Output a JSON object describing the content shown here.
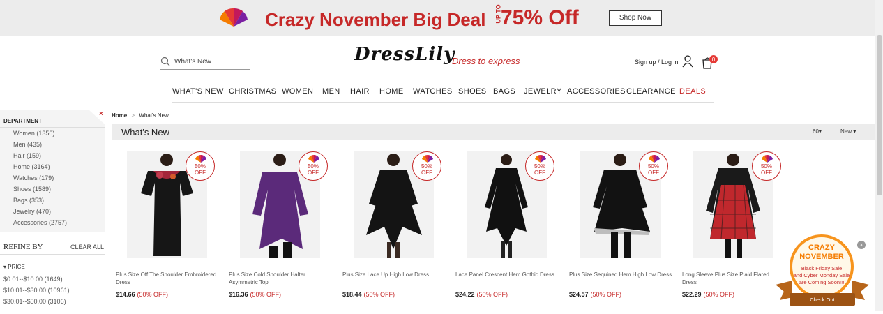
{
  "promo": {
    "headline": "Crazy November Big Deal",
    "upto": "UP TO",
    "percent": "75% Off",
    "button": "Shop Now"
  },
  "header": {
    "search_placeholder": "What's New",
    "brand": "DressLily",
    "tagline": "Dress to express",
    "signin": "Sign up / Log in",
    "cart_count": "0"
  },
  "nav": [
    "WHAT'S NEW",
    "CHRISTMAS",
    "WOMEN",
    "MEN",
    "HAIR",
    "HOME",
    "WATCHES",
    "SHOES",
    "BAGS",
    "JEWELRY",
    "ACCESSORIES",
    "CLEARANCE",
    "DEALS"
  ],
  "sidebar": {
    "title": "DEPARTMENT",
    "close": "×",
    "departments": [
      "Women (1356)",
      "Men (435)",
      "Hair (159)",
      "Home (3164)",
      "Watches (179)",
      "Shoes (1589)",
      "Bags (353)",
      "Jewelry (470)",
      "Accessories (2757)"
    ],
    "refine": "REFINE BY",
    "clear": "CLEAR ALL",
    "price_heading": "▾ PRICE",
    "prices": [
      "$0.01--$10.00 (1649)",
      "$10.01--$30.00 (10961)",
      "$30.01--$50.00 (3106)"
    ]
  },
  "breadcrumb": {
    "home": "Home",
    "sep": ">",
    "current": "What's New"
  },
  "listing": {
    "title": "What's New",
    "per_page": "60▾",
    "sort": "New ▾"
  },
  "badge": {
    "pct": "50%",
    "off": "OFF"
  },
  "products": [
    {
      "name": "Plus Size Off The Shoulder Embroidered Dress",
      "price": "$14.66",
      "discount": "(50% OFF)"
    },
    {
      "name": "Plus Size Cold Shoulder Halter Asymmetric Top",
      "price": "$16.36",
      "discount": "(50% OFF)"
    },
    {
      "name": "Plus Size Lace Up High Low Dress",
      "price": "$18.44",
      "discount": "(50% OFF)"
    },
    {
      "name": "Lace Panel Crescent Hem Gothic Dress",
      "price": "$24.22",
      "discount": "(50% OFF)"
    },
    {
      "name": "Plus Size Sequined Hem High Low Dress",
      "price": "$24.57",
      "discount": "(50% OFF)"
    },
    {
      "name": "Long Sleeve Plus Size Plaid Flared Dress",
      "price": "$22.29",
      "discount": "(50% OFF)"
    }
  ],
  "popup": {
    "crazy": "CRAZY",
    "november": "NOVEMBER",
    "line1": "Black Friday Sale",
    "line2": "and Cyber Monday Sale",
    "line3": "are Coming Soon!!!",
    "cta": "Check Out",
    "close": "×"
  },
  "colors": {
    "accent": "#c62828",
    "promo_bg": "#ececec",
    "popup_orange": "#f7941d"
  }
}
